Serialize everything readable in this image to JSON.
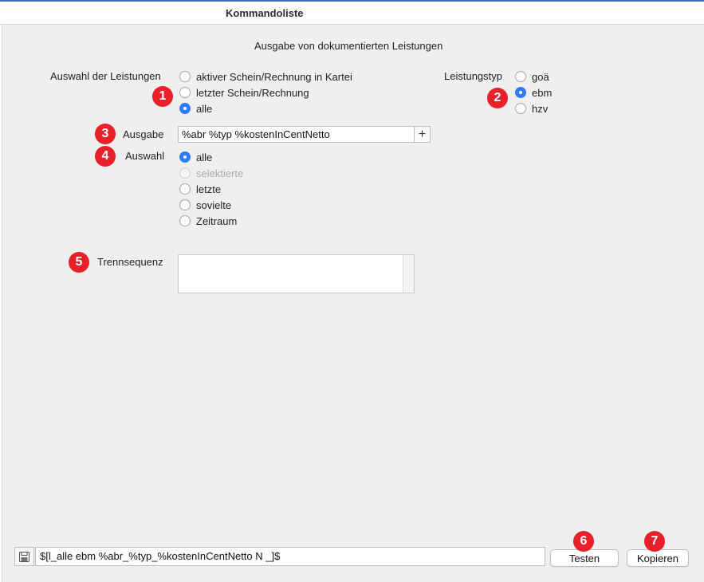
{
  "window": {
    "title": "Kommandoliste"
  },
  "heading": "Ausgabe von dokumentierten Leistungen",
  "selection_services": {
    "label": "Auswahl der Leistungen",
    "options": [
      {
        "label": "aktiver Schein/Rechnung in Kartei",
        "checked": false
      },
      {
        "label": "letzter Schein/Rechnung",
        "checked": false
      },
      {
        "label": "alle",
        "checked": true
      }
    ]
  },
  "service_type": {
    "label": "Leistungstyp",
    "options": [
      {
        "label": "goä",
        "checked": false
      },
      {
        "label": "ebm",
        "checked": true
      },
      {
        "label": "hzv",
        "checked": false
      }
    ]
  },
  "output": {
    "label": "Ausgabe",
    "value": "%abr %typ %kostenInCentNetto",
    "add_button": "+"
  },
  "choice": {
    "label": "Auswahl",
    "options": [
      {
        "label": "alle",
        "checked": true,
        "disabled": false
      },
      {
        "label": "selektierte",
        "checked": false,
        "disabled": true
      },
      {
        "label": "letzte",
        "checked": false,
        "disabled": false
      },
      {
        "label": "sovielte",
        "checked": false,
        "disabled": false
      },
      {
        "label": "Zeitraum",
        "checked": false,
        "disabled": false
      }
    ]
  },
  "separator": {
    "label": "Trennsequenz",
    "value": ""
  },
  "command": {
    "value": "$[l_alle ebm %abr_%typ_%kostenInCentNetto N _]$"
  },
  "buttons": {
    "test": "Testen",
    "copy": "Kopieren"
  },
  "badges": [
    "1",
    "2",
    "3",
    "4",
    "5",
    "6",
    "7"
  ],
  "colors": {
    "badge": "#e8202a",
    "radio_selected": "#2f7cf6",
    "panel_bg": "#efefef"
  }
}
